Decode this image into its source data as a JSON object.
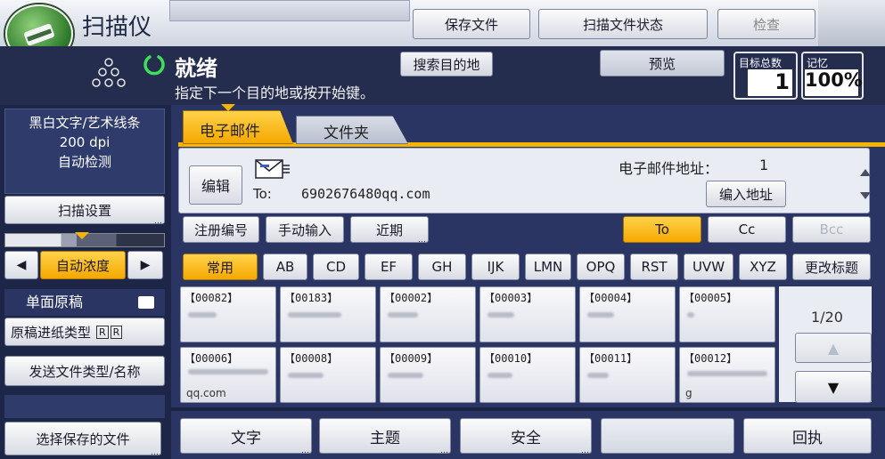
{
  "app_title": "扫描仪",
  "top_buttons": {
    "save_file": "保存文件",
    "scan_status": "扫描文件状态",
    "check": "检查"
  },
  "status": {
    "state": "就绪",
    "hint": "指定下一个目的地或按开始键。",
    "search": "搜索目的地",
    "preview": "预览"
  },
  "counters": {
    "dest_label": "目标总数",
    "dest_value": "1",
    "mem_label": "记忆",
    "mem_value": "100%"
  },
  "left_panel": {
    "mode_lines": [
      "黑白文字/艺术线条",
      "200 dpi",
      "自动检测"
    ],
    "scan_settings": "扫描设置",
    "density": "自动浓度",
    "original_header": "单面原稿",
    "feed_type": "原稿进纸类型",
    "send_type": "发送文件类型/名称",
    "select_saved": "选择保存的文件"
  },
  "tabs": [
    {
      "label": "电子邮件"
    },
    {
      "label": "文件夹"
    }
  ],
  "address": {
    "edit": "编辑",
    "count_label": "电子邮件地址：",
    "count_value": "1",
    "to_label": "To:",
    "to_value": "6902676480qq.com",
    "enter_address": "编入地址"
  },
  "entry_row": {
    "reg_no": "注册编号",
    "manual": "手动输入",
    "recent": "近期",
    "to": "To",
    "cc": "Cc",
    "bcc": "Bcc"
  },
  "index_tabs": [
    "常用",
    "AB",
    "CD",
    "EF",
    "GH",
    "IJK",
    "LMN",
    "OPQ",
    "RST",
    "UVW",
    "XYZ"
  ],
  "change_title": "更改标题",
  "dest_cells": [
    {
      "id": "【00082】",
      "name": ""
    },
    {
      "id": "【00183】",
      "name": ""
    },
    {
      "id": "【00002】",
      "name": ""
    },
    {
      "id": "【00003】",
      "name": ""
    },
    {
      "id": "【00004】",
      "name": ""
    },
    {
      "id": "【00005】",
      "name": ""
    },
    {
      "id": "【00006】",
      "name": "qq.com"
    },
    {
      "id": "【00008】",
      "name": ""
    },
    {
      "id": "【00009】",
      "name": ""
    },
    {
      "id": "【00010】",
      "name": ""
    },
    {
      "id": "【00011】",
      "name": ""
    },
    {
      "id": "【00012】",
      "name": "g"
    }
  ],
  "page_indicator": "1/20",
  "bottom_buttons": {
    "text": "文字",
    "subject": "主题",
    "security": "安全",
    "reply": "回执"
  }
}
